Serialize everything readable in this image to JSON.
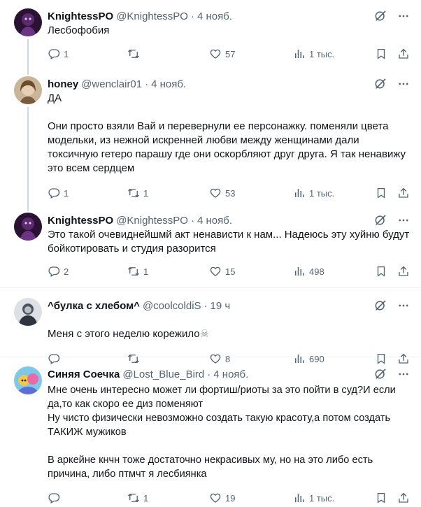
{
  "tweets": [
    {
      "name": "KnightessPO",
      "handle": "@KnightessPO",
      "time": "4 нояб.",
      "text": "Лесбофобия",
      "replies": "1",
      "retweets": "",
      "likes": "57",
      "views": "1 тыс."
    },
    {
      "name": "honey",
      "handle": "@wenclair01",
      "time": "4 нояб.",
      "text": "ДА\n\nОни просто взяли Вай и перевернули ее персонажку. поменяли цвета\nмодельки, из нежной искренней любви между женщинами дали\nтоксичную гетеро парашу где они оскорбляют друг друга. Я так ненавижу\nэто всем сердцем",
      "replies": "1",
      "retweets": "1",
      "likes": "53",
      "views": "1 тыс."
    },
    {
      "name": "KnightessPO",
      "handle": "@KnightessPO",
      "time": "4 нояб.",
      "text": "Это такой очевиднейшмй акт ненависти к нам... Надеюсь эту хуйню будут\nбойкотировать и студия разорится",
      "replies": "2",
      "retweets": "1",
      "likes": "15",
      "views": "498"
    },
    {
      "name": "^булка с хлебом^",
      "handle": "@coolcoldiS",
      "time": "19 ч",
      "text": "Меня с этого неделю корежило",
      "emoji": "☠",
      "replies": "",
      "retweets": "",
      "likes": "8",
      "views": "690"
    },
    {
      "name": "Синяя Соечка",
      "handle": "@Lost_Blue_Bird",
      "time": "4 нояб.",
      "text": "Мне очень интересно может ли фортиш/риоты за это пойти в суд?И если\nда,то как скоро ее диз поменяют\nНу чисто физически невозможно создать такую красоту,а потом создать\nТАКИЖ мужиков\n\nВ аркейне кнчн тоже достаточно некрасивых му, но на это либо есть\nпричина, либо птмчт я лесбиянка",
      "replies": "",
      "retweets": "1",
      "likes": "19",
      "views": "1 тыс."
    }
  ],
  "separator": "·",
  "icons": {
    "grok": "grok-icon",
    "more": "more-icon",
    "reply": "reply-icon",
    "retweet": "retweet-icon",
    "like": "heart-icon",
    "views": "views-icon",
    "bookmark": "bookmark-icon",
    "share": "share-icon"
  },
  "colors": {
    "text": "#0f1419",
    "secondary": "#536471",
    "border": "#eff3f4",
    "thread_line": "#cfd9de"
  }
}
